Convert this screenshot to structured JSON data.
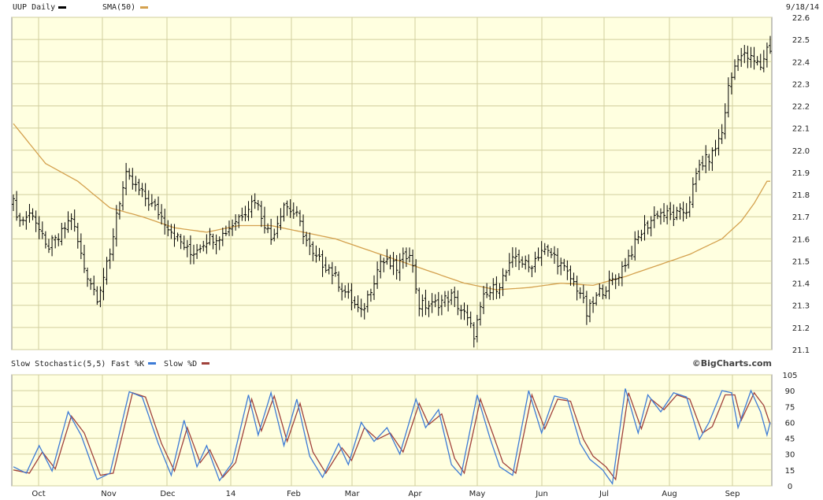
{
  "colors": {
    "panel_bg": "#FFFFE0",
    "grid": "#D2CF9E",
    "price": "#000000",
    "sma": "#D4A14E",
    "fast_k": "#3D7BD6",
    "slow_d": "#A0413B"
  },
  "header": {
    "symbol_label": "UUP Daily",
    "sma_label": "SMA(50)",
    "date_label": "9/18/14"
  },
  "lower_header": {
    "indicator_label": "Slow Stochastic(5,5)",
    "fast_label": "Fast %K",
    "slow_label": "Slow %D",
    "brand": "©BigCharts.com"
  },
  "chart_data": [
    {
      "type": "ohlc",
      "title": "UUP Daily",
      "date_range": [
        "2013-09-19",
        "2014-09-18"
      ],
      "x_ticks": [
        "Oct",
        "Nov",
        "Dec",
        "14",
        "Feb",
        "Mar",
        "Apr",
        "May",
        "Jun",
        "Jul",
        "Aug",
        "Sep"
      ],
      "ylim": [
        21.1,
        22.6
      ],
      "y_ticks": [
        21.1,
        21.2,
        21.3,
        21.4,
        21.5,
        21.6,
        21.7,
        21.8,
        21.9,
        22.0,
        22.1,
        22.2,
        22.3,
        22.4,
        22.5,
        22.6
      ],
      "y_tick_labels": [
        "21.1",
        "21.2",
        "21.3",
        "21.4",
        "21.5",
        "21.6",
        "21.7",
        "21.8",
        "21.9",
        "22.0",
        "22.1",
        "22.2",
        "22.3",
        "22.4",
        "22.5",
        "22.6"
      ],
      "grid": true,
      "price_anchors": [
        [
          0,
          21.76
        ],
        [
          2,
          21.68
        ],
        [
          6,
          21.72
        ],
        [
          10,
          21.56
        ],
        [
          14,
          21.6
        ],
        [
          18,
          21.7
        ],
        [
          22,
          21.47
        ],
        [
          26,
          21.34
        ],
        [
          30,
          21.52
        ],
        [
          32,
          21.72
        ],
        [
          35,
          21.88
        ],
        [
          40,
          21.8
        ],
        [
          45,
          21.72
        ],
        [
          50,
          21.62
        ],
        [
          55,
          21.53
        ],
        [
          60,
          21.6
        ],
        [
          65,
          21.62
        ],
        [
          70,
          21.7
        ],
        [
          75,
          21.78
        ],
        [
          80,
          21.6
        ],
        [
          84,
          21.76
        ],
        [
          88,
          21.7
        ],
        [
          93,
          21.52
        ],
        [
          98,
          21.47
        ],
        [
          102,
          21.38
        ],
        [
          108,
          21.26
        ],
        [
          114,
          21.5
        ],
        [
          119,
          21.47
        ],
        [
          123,
          21.55
        ],
        [
          126,
          21.3
        ],
        [
          130,
          21.3
        ],
        [
          136,
          21.34
        ],
        [
          140,
          21.26
        ],
        [
          143,
          21.17
        ],
        [
          146,
          21.33
        ],
        [
          151,
          21.4
        ],
        [
          156,
          21.52
        ],
        [
          160,
          21.47
        ],
        [
          164,
          21.55
        ],
        [
          168,
          21.52
        ],
        [
          172,
          21.44
        ],
        [
          176,
          21.36
        ],
        [
          178,
          21.26
        ],
        [
          182,
          21.36
        ],
        [
          187,
          21.42
        ],
        [
          191,
          21.52
        ],
        [
          195,
          21.63
        ],
        [
          200,
          21.72
        ],
        [
          205,
          21.7
        ],
        [
          209,
          21.73
        ],
        [
          213,
          21.93
        ],
        [
          217,
          21.98
        ],
        [
          220,
          22.08
        ],
        [
          222,
          22.28
        ],
        [
          225,
          22.43
        ],
        [
          228,
          22.42
        ],
        [
          232,
          22.38
        ],
        [
          234,
          22.46
        ]
      ],
      "sma_series": {
        "name": "SMA(50)",
        "anchors": [
          [
            0,
            22.12
          ],
          [
            10,
            21.94
          ],
          [
            20,
            21.86
          ],
          [
            30,
            21.74
          ],
          [
            40,
            21.7
          ],
          [
            50,
            21.65
          ],
          [
            60,
            21.63
          ],
          [
            70,
            21.66
          ],
          [
            80,
            21.66
          ],
          [
            90,
            21.63
          ],
          [
            100,
            21.6
          ],
          [
            110,
            21.55
          ],
          [
            120,
            21.5
          ],
          [
            130,
            21.45
          ],
          [
            140,
            21.4
          ],
          [
            150,
            21.37
          ],
          [
            160,
            21.38
          ],
          [
            170,
            21.4
          ],
          [
            180,
            21.39
          ],
          [
            190,
            21.43
          ],
          [
            200,
            21.48
          ],
          [
            210,
            21.53
          ],
          [
            220,
            21.6
          ],
          [
            226,
            21.68
          ],
          [
            230,
            21.76
          ],
          [
            234,
            21.86
          ]
        ]
      }
    },
    {
      "type": "line",
      "title": "Slow Stochastic(5,5)",
      "ylim": [
        0,
        105
      ],
      "y_ticks": [
        0,
        15,
        30,
        45,
        60,
        75,
        90,
        105
      ],
      "y_tick_labels": [
        "0",
        "15",
        "30",
        "45",
        "60",
        "75",
        "90",
        "105"
      ],
      "grid": true,
      "series": [
        {
          "name": "Fast %K",
          "anchors": [
            [
              0,
              18
            ],
            [
              4,
              12
            ],
            [
              8,
              38
            ],
            [
              12,
              14
            ],
            [
              17,
              70
            ],
            [
              21,
              48
            ],
            [
              26,
              6
            ],
            [
              30,
              12
            ],
            [
              36,
              89
            ],
            [
              40,
              84
            ],
            [
              45,
              40
            ],
            [
              49,
              10
            ],
            [
              53,
              62
            ],
            [
              57,
              18
            ],
            [
              60,
              38
            ],
            [
              64,
              5
            ],
            [
              68,
              22
            ],
            [
              73,
              86
            ],
            [
              76,
              48
            ],
            [
              80,
              88
            ],
            [
              84,
              38
            ],
            [
              88,
              82
            ],
            [
              92,
              28
            ],
            [
              96,
              8
            ],
            [
              101,
              40
            ],
            [
              104,
              20
            ],
            [
              108,
              60
            ],
            [
              112,
              42
            ],
            [
              116,
              55
            ],
            [
              120,
              30
            ],
            [
              125,
              82
            ],
            [
              128,
              55
            ],
            [
              132,
              72
            ],
            [
              136,
              20
            ],
            [
              139,
              10
            ],
            [
              144,
              86
            ],
            [
              148,
              45
            ],
            [
              151,
              18
            ],
            [
              155,
              10
            ],
            [
              160,
              90
            ],
            [
              164,
              50
            ],
            [
              168,
              85
            ],
            [
              172,
              82
            ],
            [
              176,
              40
            ],
            [
              179,
              25
            ],
            [
              183,
              15
            ],
            [
              186,
              2
            ],
            [
              190,
              92
            ],
            [
              194,
              50
            ],
            [
              197,
              86
            ],
            [
              201,
              70
            ],
            [
              205,
              88
            ],
            [
              209,
              84
            ],
            [
              213,
              44
            ],
            [
              216,
              60
            ],
            [
              220,
              90
            ],
            [
              223,
              88
            ],
            [
              225,
              55
            ],
            [
              229,
              90
            ],
            [
              232,
              70
            ],
            [
              234,
              48
            ],
            [
              235,
              60
            ]
          ]
        },
        {
          "name": "Slow %D",
          "anchors": [
            [
              0,
              15
            ],
            [
              5,
              12
            ],
            [
              9,
              32
            ],
            [
              13,
              16
            ],
            [
              18,
              66
            ],
            [
              22,
              50
            ],
            [
              27,
              10
            ],
            [
              31,
              12
            ],
            [
              37,
              88
            ],
            [
              41,
              84
            ],
            [
              46,
              40
            ],
            [
              50,
              14
            ],
            [
              54,
              55
            ],
            [
              58,
              22
            ],
            [
              61,
              34
            ],
            [
              65,
              8
            ],
            [
              69,
              22
            ],
            [
              74,
              82
            ],
            [
              77,
              52
            ],
            [
              81,
              85
            ],
            [
              85,
              42
            ],
            [
              89,
              78
            ],
            [
              93,
              32
            ],
            [
              97,
              12
            ],
            [
              102,
              36
            ],
            [
              105,
              24
            ],
            [
              109,
              55
            ],
            [
              113,
              44
            ],
            [
              117,
              50
            ],
            [
              121,
              32
            ],
            [
              126,
              78
            ],
            [
              129,
              58
            ],
            [
              133,
              68
            ],
            [
              137,
              26
            ],
            [
              140,
              12
            ],
            [
              145,
              82
            ],
            [
              149,
              48
            ],
            [
              152,
              22
            ],
            [
              156,
              12
            ],
            [
              161,
              86
            ],
            [
              165,
              54
            ],
            [
              169,
              82
            ],
            [
              173,
              80
            ],
            [
              177,
              44
            ],
            [
              180,
              28
            ],
            [
              184,
              18
            ],
            [
              187,
              6
            ],
            [
              191,
              88
            ],
            [
              195,
              54
            ],
            [
              198,
              82
            ],
            [
              202,
              72
            ],
            [
              206,
              86
            ],
            [
              210,
              82
            ],
            [
              214,
              50
            ],
            [
              217,
              56
            ],
            [
              221,
              86
            ],
            [
              224,
              86
            ],
            [
              226,
              62
            ],
            [
              230,
              88
            ],
            [
              233,
              76
            ],
            [
              235,
              58
            ]
          ]
        }
      ]
    }
  ]
}
